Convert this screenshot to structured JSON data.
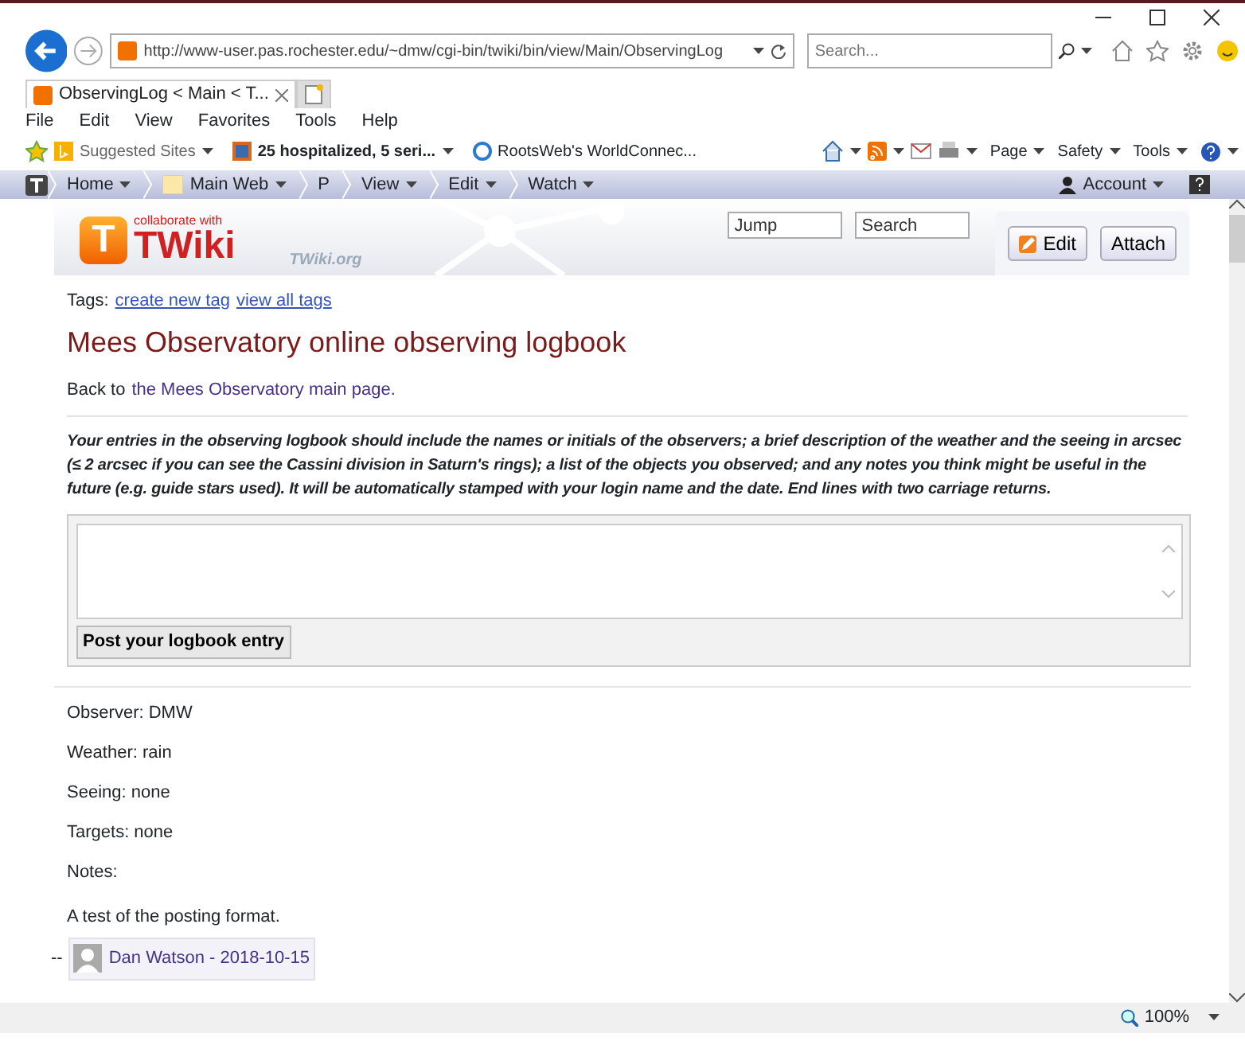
{
  "address_bar": {
    "url": "http://www-user.pas.rochester.edu/~dmw/cgi-bin/twiki/bin/view/Main/ObservingLog",
    "search_placeholder": "Search..."
  },
  "tabs": [
    {
      "label": "ObservingLog < Main < T...",
      "selected": true
    }
  ],
  "menu": [
    "File",
    "Edit",
    "View",
    "Favorites",
    "Tools",
    "Help"
  ],
  "favorites": [
    "Suggested Sites",
    "25 hospitalized, 5 seri...",
    "RootsWeb's WorldConnec..."
  ],
  "command_bar": [
    "Page",
    "Safety",
    "Tools"
  ],
  "twiki_bar": {
    "items": [
      "Home",
      "Main Web",
      "P",
      "View",
      "Edit",
      "Watch"
    ],
    "account": "Account"
  },
  "header": {
    "logo_tagline": "collaborate with",
    "logo_mark": "T",
    "logo": "TWiki",
    "site": "TWiki.org",
    "jump_placeholder": "Jump",
    "search_placeholder": "Search",
    "buttons": [
      "Edit",
      "Attach"
    ]
  },
  "tags": {
    "label": "Tags:",
    "links": [
      "create new tag",
      "view all tags"
    ]
  },
  "title": "Mees Observatory online observing logbook",
  "back": {
    "text": "Back to",
    "link": "the Mees Observatory main page."
  },
  "instructions": "Your entries in the observing logbook should include the names or initials of the observers; a brief description of the weather and the seeing in arcsec (≤ 2 arcsec if you can see the Cassini division in Saturn's rings); a list of the objects you observed; and any notes you think might be useful in the future (e.g. guide stars used). It will be automatically stamped with your login name and the date. End lines with two carriage returns.",
  "post_button": "Post your logbook entry",
  "entry": {
    "lines": [
      "Observer: DMW",
      "Weather: rain",
      "Seeing: none",
      "Targets: none",
      "Notes:",
      "A test of the posting format."
    ],
    "dash": "--",
    "signature": "Dan Watson - 2018-10-15"
  },
  "status_bar": {
    "zoom": "100%"
  }
}
